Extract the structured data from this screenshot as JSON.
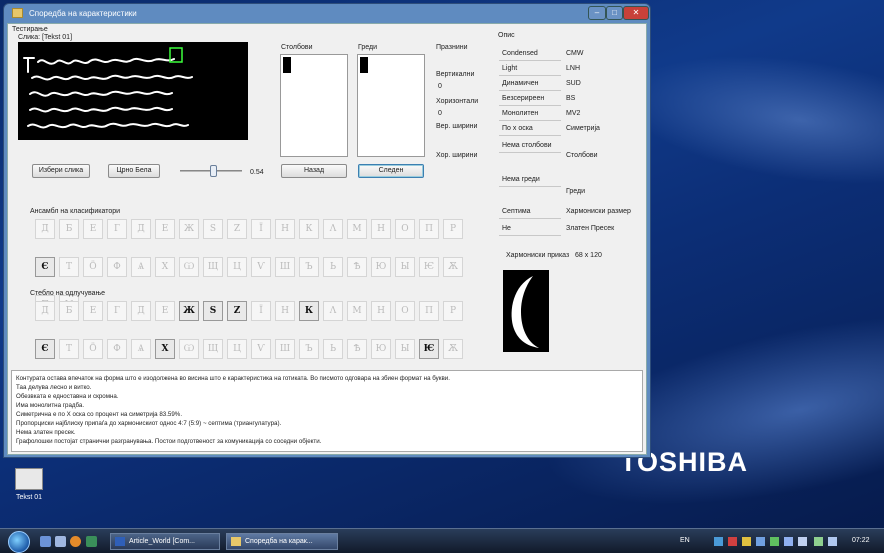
{
  "window": {
    "title": "Споредба на карактеристики",
    "controls": {
      "minimize": "–",
      "maximize": "□",
      "close": "✕"
    }
  },
  "testing": {
    "group_label": "Тестирање",
    "image_label": "Слика: [Tekst 01]",
    "choose_image_button": "Избери слика",
    "bw_button": "Црно Бела",
    "threshold_value": "0.54",
    "threshold_level": 0.54,
    "columns_label": "Столбови",
    "rows_label": "Греди",
    "empty_label": "Празнини",
    "vertical_label": "Вертикални",
    "vertical_value": "0",
    "horizontal_label": "Хоризонтали",
    "horizontal_value": "0",
    "vert_widths_label": "Вер. ширини",
    "hor_widths_label": "Хор. ширини",
    "back_button": "Назад",
    "next_button": "Следен"
  },
  "description": {
    "group_label": "Опис",
    "properties": [
      {
        "label": "Condensed",
        "value": "CMW"
      },
      {
        "label": "Light",
        "value": "LNH"
      },
      {
        "label": "Динамичен",
        "value": "SUD"
      },
      {
        "label": "Безсериреен",
        "value": "BS"
      },
      {
        "label": "Монолитен",
        "value": "MV2"
      },
      {
        "label": "По х оска",
        "value": "Симетрија"
      },
      {
        "label": "Нема столбови",
        "value": "Столбови"
      },
      {
        "label": "Нема греди",
        "value": "Греди"
      },
      {
        "label": "Септима",
        "value": "Хармониски размер"
      },
      {
        "label": "Не",
        "value": "Златен Пресек"
      }
    ],
    "harmonic_label": "Хармониски приказ",
    "harmonic_size": "68 x 120"
  },
  "ensemble": {
    "label": "Ансамбл на класификатори",
    "row1": [
      "Д",
      "Б",
      "Е",
      "Г",
      "Д",
      "Е",
      "Ж",
      "Ѕ",
      "Ζ",
      "Ї",
      "Н",
      "К",
      "Λ",
      "М",
      "Н",
      "О",
      "П",
      "Ρ",
      "Є"
    ],
    "row2": [
      "Т",
      "Ӧ",
      "Ф",
      "Ѧ",
      "Χ",
      "Ѡ",
      "Щ",
      "Ц",
      "Ѵ",
      "Ш",
      "Ъ",
      "Ь",
      "Ѣ",
      "Ю",
      "Ы",
      "Ѥ",
      "Ѫ",
      "Ѫ",
      "Ѵ"
    ],
    "active_row1": [
      18
    ],
    "active_row2": []
  },
  "decision_tree": {
    "label": "Стебло на одлучување",
    "row1": [
      "Д",
      "Б",
      "Е",
      "Г",
      "Д",
      "Е",
      "Ж",
      "Ѕ",
      "Ζ",
      "Ї",
      "Н",
      "К",
      "Λ",
      "М",
      "Н",
      "О",
      "П",
      "Ρ",
      "Є"
    ],
    "row2": [
      "Т",
      "Ӧ",
      "Ф",
      "Ѧ",
      "Χ",
      "Ѡ",
      "Щ",
      "Ц",
      "Ѵ",
      "Ш",
      "Ъ",
      "Ь",
      "Ѣ",
      "Ю",
      "Ы",
      "Ѥ",
      "Ѫ",
      "Ѫ",
      "Ѵ"
    ],
    "active_row1": [
      6,
      7,
      8,
      11,
      18
    ],
    "active_row2": [
      4,
      15
    ]
  },
  "info_lines": [
    "Контурата остава впечаток на форма што е изодолжена во висина што е карактеристика на готиката. Во писмото одговара на збиен формат на букви.",
    "Таа делува лесно и витко.",
    "Обезвката е едноставна и скромна.",
    "Има монолитна градба.",
    "Симетрична е по Х оска со процент на симетрија 83.59%.",
    "Пропорциски најблиску припаѓа до хармонискиот однос 4:7 (5:9) ~ септима (триангулатура).",
    "Нема златен пресек.",
    "Графолошки постојат странични разгранувања. Постои подготвеност за комуникација со соседни објекти."
  ],
  "desktop": {
    "brand": "TOSHIBA",
    "icon_label": "Tekst 01"
  },
  "taskbar": {
    "buttons": [
      "Article_World [Com...",
      "Споредба на карак..."
    ],
    "lang": "EN",
    "clock": "07:22"
  }
}
